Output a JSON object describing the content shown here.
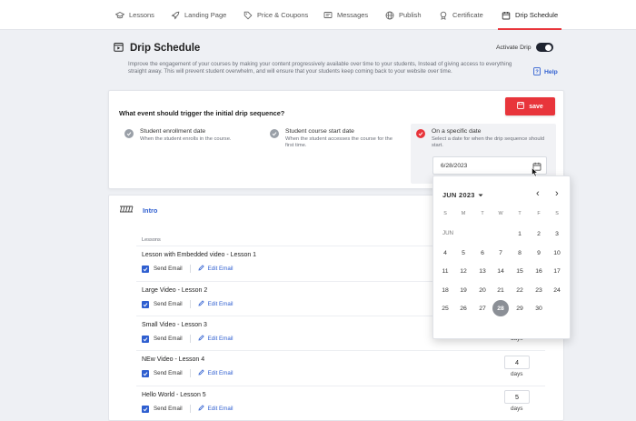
{
  "tabs": [
    {
      "label": "Lessons",
      "icon": "graduation-cap-icon"
    },
    {
      "label": "Landing Page",
      "icon": "rocket-icon"
    },
    {
      "label": "Price & Coupons",
      "icon": "tag-icon"
    },
    {
      "label": "Messages",
      "icon": "message-icon"
    },
    {
      "label": "Publish",
      "icon": "globe-icon"
    },
    {
      "label": "Certificate",
      "icon": "certificate-icon"
    },
    {
      "label": "Drip Schedule",
      "icon": "calendar-icon",
      "active": true
    }
  ],
  "header": {
    "title": "Drip Schedule",
    "description": "Improve the engagement of your courses by making your content progressively available over time to your students, Instead of giving access to everything straight away. This will prevent student overwhelm, and will ensure that your students keep coming back to your website over time.",
    "activate_label": "Activate Drip",
    "activate_on": true,
    "help_label": "Help"
  },
  "trigger": {
    "question": "What event should trigger the initial drip sequence?",
    "save_label": "save",
    "options": [
      {
        "title": "Student enrollment date",
        "subtitle": "When the student enrolls in the course."
      },
      {
        "title": "Student course start date",
        "subtitle": "When the student accesses the course for the first time."
      },
      {
        "title": "On a specific date",
        "subtitle": "Select a date for when the drip sequence should start.",
        "selected": true
      }
    ],
    "date_value": "6/28/2023"
  },
  "section": {
    "title": "Intro",
    "lessons_label": "Lessons",
    "lessons": [
      {
        "title": "Lesson with Embedded video - Lesson 1",
        "send_email": "Send Email",
        "edit_email": "Edit Email"
      },
      {
        "title": "Large Video - Lesson 2",
        "send_email": "Send Email",
        "edit_email": "Edit Email"
      },
      {
        "title": "Small Video - Lesson 3",
        "send_email": "Send Email",
        "edit_email": "Edit Email",
        "days_label": "days"
      },
      {
        "title": "NEw Video - Lesson 4",
        "send_email": "Send Email",
        "edit_email": "Edit Email",
        "days": "4",
        "days_label": "days"
      },
      {
        "title": "Hello World - Lesson 5",
        "send_email": "Send Email",
        "edit_email": "Edit Email",
        "days": "5",
        "days_label": "days"
      }
    ]
  },
  "calendar": {
    "month_label": "JUN 2023",
    "month_short": "JUN",
    "weekdays": [
      "S",
      "M",
      "T",
      "W",
      "T",
      "F",
      "S"
    ],
    "prev": "‹",
    "next": "›",
    "selected_day": "28",
    "days": [
      "1",
      "2",
      "3",
      "4",
      "5",
      "6",
      "7",
      "8",
      "9",
      "10",
      "11",
      "12",
      "13",
      "14",
      "15",
      "16",
      "17",
      "18",
      "19",
      "20",
      "21",
      "22",
      "23",
      "24",
      "25",
      "26",
      "27",
      "28",
      "29",
      "30"
    ]
  }
}
